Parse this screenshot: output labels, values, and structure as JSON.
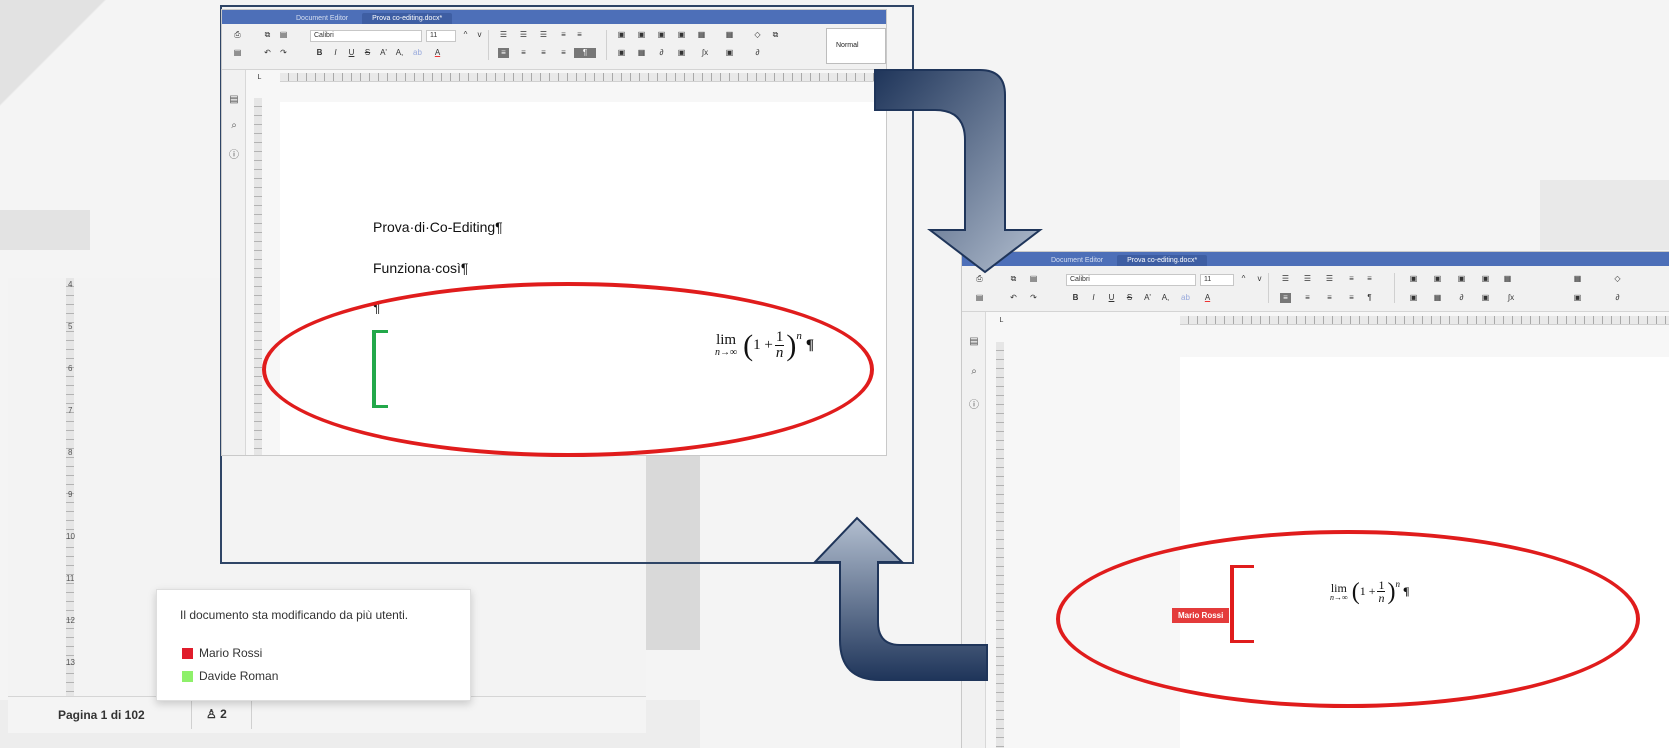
{
  "colors": {
    "titlebar": "#4d6fb8",
    "ellipse": "#e01c1c",
    "bracket_green": "#22a84a",
    "bracket_red": "#e01c1c",
    "arrow_dark": "#1f355a",
    "arrow_light": "#aab6c9"
  },
  "editor_top": {
    "app_title": "Document Editor",
    "doc_tab": "Prova co-editing.docx*",
    "font_name": "Calibri",
    "font_size": "11",
    "style_name": "Normal",
    "line1": "Prova·di·Co-Editing¶",
    "line2": "Funziona·così¶",
    "line3": "¶"
  },
  "editor_bottom": {
    "app_title": "Document Editor",
    "doc_tab": "Prova co-editing.docx*",
    "font_name": "Calibri",
    "font_size": "11",
    "user_tag": "Mario Rossi"
  },
  "formula": {
    "lim": "lim",
    "sub": "n→∞",
    "one": "1 +",
    "num": "1",
    "den": "n",
    "exp": "n",
    "pilcrow": "¶"
  },
  "toolbar_icons": {
    "print": "⎙",
    "copy": "⧉",
    "paste": "▤",
    "undo": "↶",
    "redo": "↷",
    "bold": "B",
    "italic": "I",
    "underline": "U",
    "strike": "S",
    "superscript": "A'",
    "subscript": "A,",
    "highlight": "ab",
    "font_color": "A",
    "align_left": "≡",
    "center": "≡",
    "right": "≡",
    "justify": "≡",
    "pilcrow": "¶",
    "bullets": "☰",
    "numbering": "☰",
    "table": "▦",
    "image": "▣",
    "link": "∂",
    "formula": "∫x",
    "eraser": "◇",
    "ruler_corner": "L",
    "sidebar_doc": "▤",
    "sidebar_search": "⌕",
    "sidebar_info": "ⓘ",
    "font_up": "^",
    "font_down": "v"
  },
  "background_doc": {
    "ruler_numbers": [
      "4",
      "5",
      "6",
      "7",
      "8",
      "9",
      "10",
      "11",
      "12",
      "13"
    ],
    "status_page": "Pagina 1 di 102",
    "users_count": "2",
    "users_icon": "♙"
  },
  "tooltip": {
    "message": "Il documento sta modificando da più utenti.",
    "users": [
      {
        "name": "Mario Rossi",
        "color": "#e01c2b"
      },
      {
        "name": "Davide Roman",
        "color": "#8ef06a"
      }
    ]
  }
}
